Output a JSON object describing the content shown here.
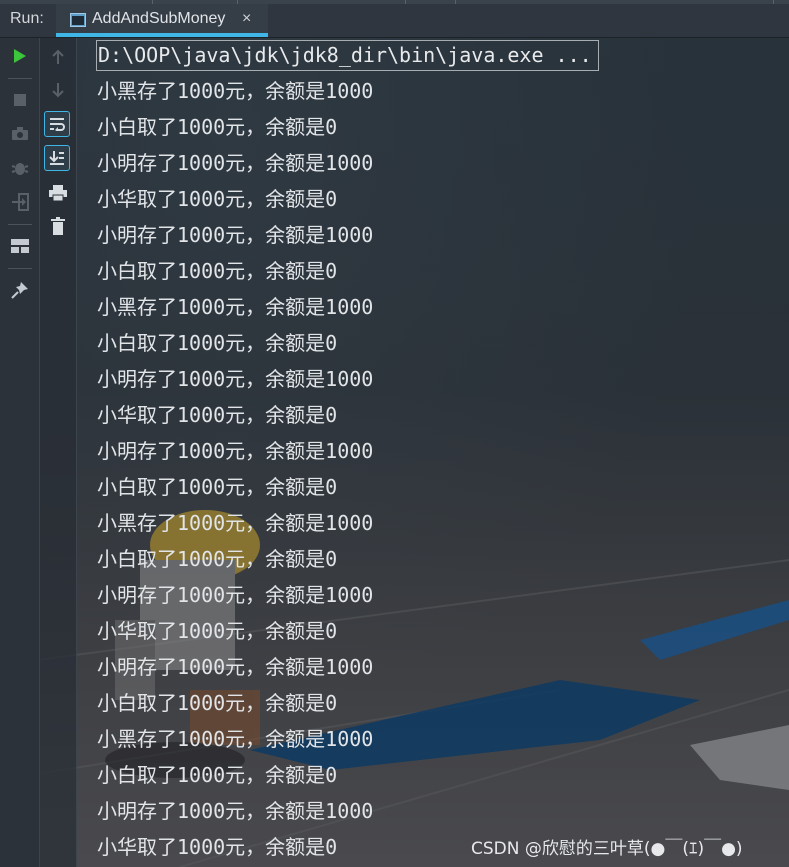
{
  "run_panel": {
    "label": "Run:",
    "tab": {
      "title": "AddAndSubMoney",
      "close_glyph": "×",
      "icon": "console-window-icon"
    }
  },
  "toolbar_left": [
    {
      "icon": "play-icon",
      "color": "#3cc43c"
    },
    {
      "icon": "stop-icon"
    },
    {
      "icon": "camera-icon"
    },
    {
      "icon": "debug-bug-icon"
    },
    {
      "icon": "exit-icon"
    },
    {
      "icon": "layout-icon"
    },
    {
      "icon": "pin-icon"
    }
  ],
  "toolbar_right": [
    {
      "icon": "arrow-up-icon"
    },
    {
      "icon": "arrow-down-icon"
    },
    {
      "icon": "soft-wrap-icon",
      "active": true
    },
    {
      "icon": "scroll-to-end-icon",
      "active": true
    },
    {
      "icon": "print-icon"
    },
    {
      "icon": "trash-icon"
    }
  ],
  "console": {
    "command": "D:\\OOP\\java\\jdk\\jdk8_dir\\bin\\java.exe ...",
    "lines": [
      "小黑存了1000元，余额是1000",
      "小白取了1000元，余额是0",
      "小明存了1000元，余额是1000",
      "小华取了1000元，余额是0",
      "小明存了1000元，余额是1000",
      "小白取了1000元，余额是0",
      "小黑存了1000元，余额是1000",
      "小白取了1000元，余额是0",
      "小明存了1000元，余额是1000",
      "小华取了1000元，余额是0",
      "小明存了1000元，余额是1000",
      "小白取了1000元，余额是0",
      "小黑存了1000元，余额是1000",
      "小白取了1000元，余额是0",
      "小明存了1000元，余额是1000",
      "小华取了1000元，余额是0",
      "小明存了1000元，余额是1000",
      "小白取了1000元，余额是0",
      "小黑存了1000元，余额是1000",
      "小白取了1000元，余额是0",
      "小明存了1000元，余额是1000",
      "小华取了1000元，余额是0"
    ]
  },
  "watermark": "CSDN @欣慰的三叶草(●￣(ｴ)￣●)",
  "colors": {
    "accent": "#3fb6e6",
    "text": "#e2e5e8",
    "run_green": "#3cc43c"
  }
}
